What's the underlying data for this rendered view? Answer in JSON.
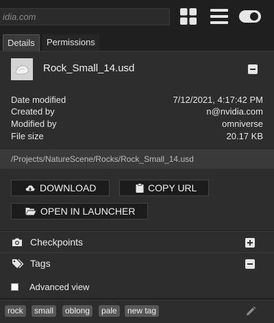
{
  "toolbar": {
    "url_text": "idia.com",
    "icons": [
      "grid-view-icon",
      "list-view-icon",
      "toggle-switch-icon"
    ]
  },
  "tabs": [
    {
      "label": "Details",
      "active": true
    },
    {
      "label": "Permissions",
      "active": false
    }
  ],
  "file": {
    "name": "Rock_Small_14.usd"
  },
  "metadata": [
    {
      "key": "Date modified",
      "value": "7/12/2021, 4:17:42 PM"
    },
    {
      "key": "Created by",
      "value": "n@nvidia.com"
    },
    {
      "key": "Modified by",
      "value": "omniverse"
    },
    {
      "key": "File size",
      "value": "20.17 KB"
    }
  ],
  "path": "/Projects/NatureScene/Rocks/Rock_Small_14.usd",
  "actions": {
    "download_label": "DOWNLOAD",
    "copy_url_label": "COPY URL",
    "open_launcher_label": "OPEN IN LAUNCHER"
  },
  "sections": {
    "checkpoints_label": "Checkpoints",
    "tags_label": "Tags"
  },
  "advanced_view_label": "Advanced view",
  "tags": [
    "rock",
    "small",
    "oblong",
    "pale",
    "new tag"
  ],
  "colors": {
    "background": "#1f1f1f",
    "panel": "#2d2d2d",
    "path_bar": "#3a3a3a",
    "tag_chip": "#575757"
  }
}
